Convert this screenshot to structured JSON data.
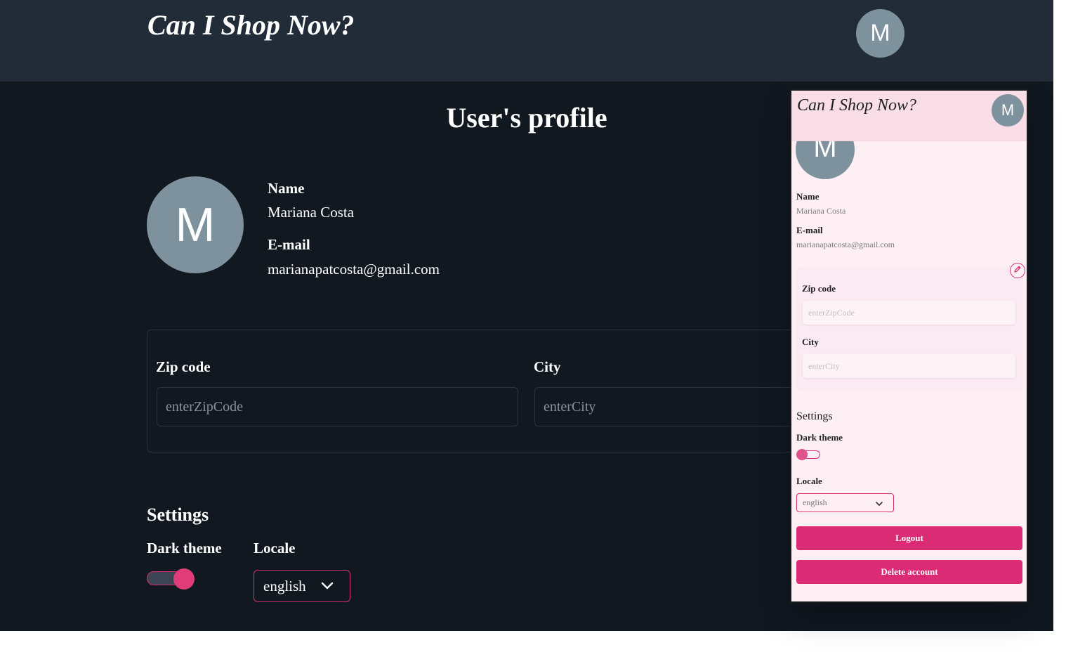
{
  "desktop": {
    "brand": "Can I Shop Now?",
    "avatar_initial": "M",
    "page_title": "User's profile",
    "profile": {
      "name_label": "Name",
      "name_value": "Mariana Costa",
      "email_label": "E-mail",
      "email_value": "marianapatcosta@gmail.com"
    },
    "address": {
      "zip_label": "Zip code",
      "zip_placeholder": "enterZipCode",
      "city_label": "City",
      "city_placeholder": "enterCity"
    },
    "settings": {
      "title": "Settings",
      "dark_theme_label": "Dark theme",
      "dark_theme_on": true,
      "locale_label": "Locale",
      "locale_value": "english"
    }
  },
  "mobile": {
    "brand": "Can I Shop Now?",
    "avatar_initial": "M",
    "profile": {
      "name_label": "Name",
      "name_value": "Mariana Costa",
      "email_label": "E-mail",
      "email_value": "marianapatcosta@gmail.com"
    },
    "address": {
      "zip_label": "Zip code",
      "zip_placeholder": "enterZipCode",
      "city_label": "City",
      "city_placeholder": "enterCity"
    },
    "settings": {
      "title": "Settings",
      "dark_theme_label": "Dark theme",
      "dark_theme_on": false,
      "locale_label": "Locale",
      "locale_value": "english"
    },
    "logout_label": "Logout",
    "delete_label": "Delete account"
  },
  "colors": {
    "dark_bg": "#111820",
    "dark_header": "#222b38",
    "accent": "#dc2b75",
    "avatar": "#7d929c",
    "light_bg": "#fdeff4"
  },
  "icons": [
    "chevron-down-icon",
    "pencil-icon"
  ]
}
